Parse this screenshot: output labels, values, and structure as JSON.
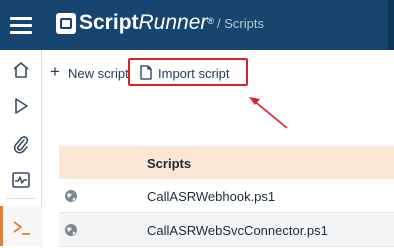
{
  "header": {
    "brand_bold": "Script",
    "brand_italic": "Runner",
    "brand_mark": "®",
    "breadcrumb": "/ Scripts"
  },
  "sidebar": {
    "items": [
      {
        "icon": "home-icon"
      },
      {
        "icon": "play-icon"
      },
      {
        "icon": "paperclip-icon"
      },
      {
        "icon": "activity-monitor-icon"
      },
      {
        "icon": "terminal-icon",
        "active": true
      }
    ]
  },
  "toolbar": {
    "new_script_label": "New script",
    "import_script_label": "Import script"
  },
  "table": {
    "header": "Scripts",
    "rows": [
      {
        "name": "CallASRWebhook.ps1",
        "icon": "globe-icon"
      },
      {
        "name": "CallASRWebSvcConnector.ps1",
        "icon": "globe-icon"
      }
    ]
  },
  "colors": {
    "topbar": "#16456f",
    "accent": "#f07e26",
    "highlight": "#d8232a",
    "table_header": "#fbe7d5"
  }
}
